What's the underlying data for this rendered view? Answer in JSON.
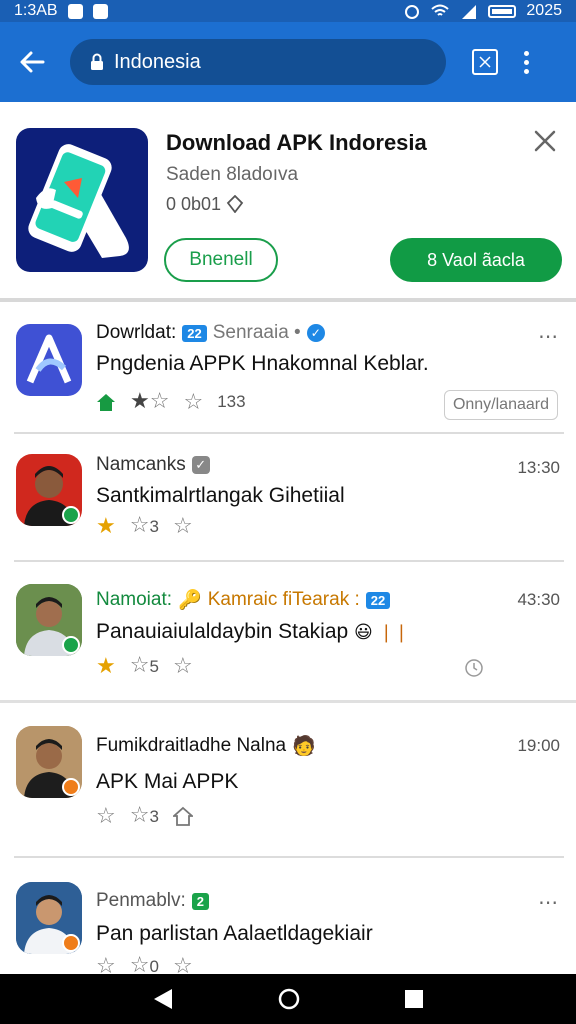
{
  "status_bar": {
    "time": "1:3AB",
    "right_text": "2025"
  },
  "url_bar": {
    "url_text": "Indonesia"
  },
  "banner": {
    "title": "Download APK Indoresia",
    "subtitle": "Saden 8ladoıva",
    "meta": "0 0b01",
    "secondary_button": "Bnenell",
    "primary_button": "8 Vaol ãacla"
  },
  "feed": [
    {
      "name": "Dowrldat:",
      "tag": "22",
      "source": "Senraaia •",
      "body": "Pngdenia APPK Hnakomnal Keblar.",
      "rating_count": "133",
      "chip": "Onny/lanaard"
    },
    {
      "name": "Namcanks",
      "time": "13:30",
      "body": "Santkimalrtlangak Gihetiial",
      "rating_count": "3"
    },
    {
      "name": "Namoiat:",
      "source": "Kamraic fiTearak :",
      "tag": "22",
      "time": "43:30",
      "body": "Panauiaiulaldaybin Stakiap",
      "rating_count": "5"
    },
    {
      "name": "Fumikdraitladhe Nalna",
      "time": "19:00",
      "body": "APK Mai APPK"
    },
    {
      "name": "Penmablv:",
      "tag": "2",
      "body": "Pan parlistan Aalaetldagekiair",
      "rating_count": "0"
    }
  ],
  "colors": {
    "app_bar": "#1c6fd1",
    "status_bar": "#1a5fb4",
    "accent_green": "#119b45",
    "star": "#e5a100"
  }
}
